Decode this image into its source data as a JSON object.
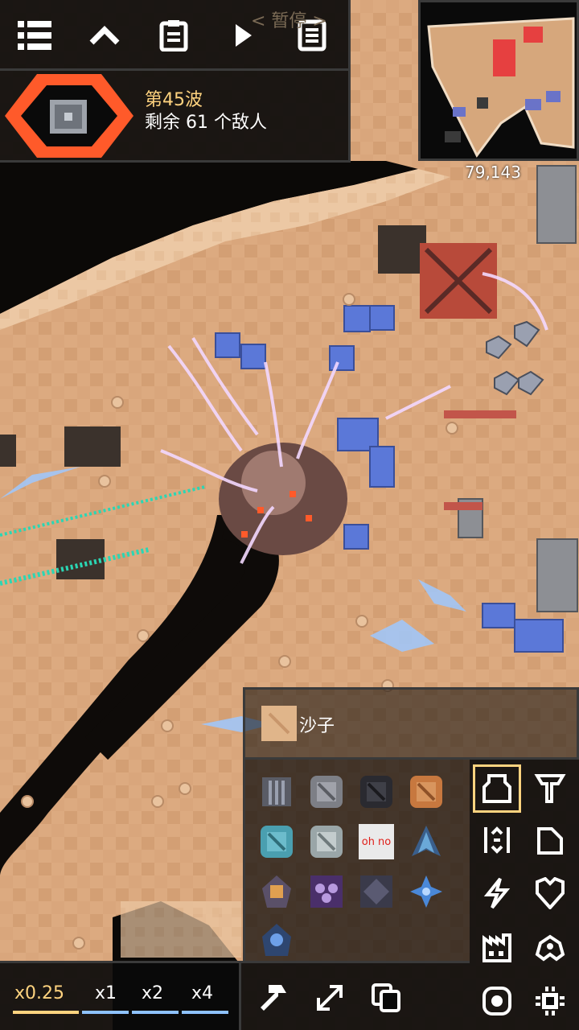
{
  "top_bar": {
    "paused_label": "< 暂停 >",
    "icons": [
      "menu-icon",
      "chevron-up-icon",
      "database-icon",
      "play-icon",
      "notes-icon"
    ]
  },
  "wave": {
    "title": "第45波",
    "enemies_text": "剩余 61 个敌人"
  },
  "minimap": {
    "coords": "79,143"
  },
  "speed": {
    "options": [
      "x0.25",
      "x1",
      "x2",
      "x4"
    ],
    "selected": "x0.25",
    "selected_color": "#ffd37f",
    "line_color": "#8ec2ff"
  },
  "block_info": {
    "name": "沙子"
  },
  "block_grid": {
    "ohno_label": "oh no",
    "items": [
      "ground-factory-icon",
      "basic-block-icon",
      "dark-block-icon",
      "orange-block-icon",
      "cyan-block-icon",
      "light-block-icon",
      "ohno-block-icon",
      "naval-unit-icon",
      "dagger-unit-icon",
      "purple-unit-icon",
      "crawler-unit-icon",
      "flare-unit-icon",
      "blue-unit-icon"
    ]
  },
  "categories": [
    "turret-icon",
    "production-icon",
    "distribution-icon",
    "liquid-icon",
    "power-icon",
    "defense-icon",
    "crafting-icon",
    "units-icon",
    "effect-icon",
    "logic-icon"
  ],
  "tools": [
    "hammer-icon",
    "expand-icon",
    "copy-icon"
  ],
  "colors": {
    "accent": "#ffd37f",
    "sand": "#e0b58a",
    "panel": "#0a0a0a",
    "border": "#3a3a3a",
    "core_red": "#ff5a2a"
  }
}
